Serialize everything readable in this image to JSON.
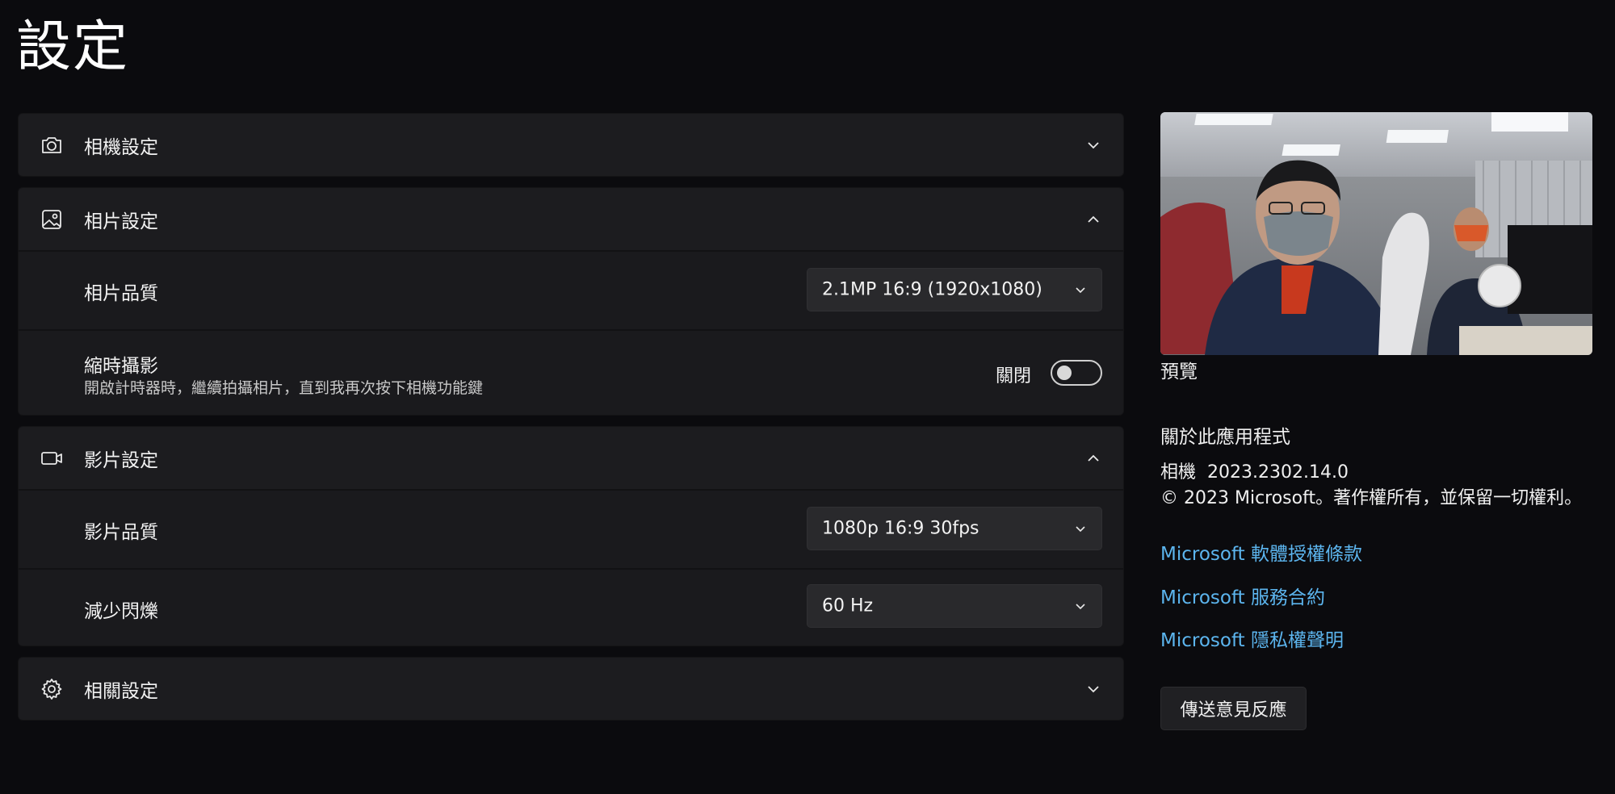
{
  "page": {
    "title": "設定"
  },
  "sections": {
    "camera": {
      "title": "相機設定",
      "icon": "camera-icon",
      "expanded": false
    },
    "photo": {
      "title": "相片設定",
      "icon": "photo-icon",
      "expanded": true,
      "quality": {
        "label": "相片品質",
        "value": "2.1MP 16:9 (1920x1080)"
      },
      "timelapse": {
        "label": "縮時攝影",
        "description": "開啟計時器時，繼續拍攝相片，直到我再次按下相機功能鍵",
        "state_label": "關閉",
        "on": false
      }
    },
    "video": {
      "title": "影片設定",
      "icon": "video-icon",
      "expanded": true,
      "quality": {
        "label": "影片品質",
        "value": "1080p 16:9 30fps"
      },
      "flicker": {
        "label": "減少閃爍",
        "value": "60 Hz"
      }
    },
    "related": {
      "title": "相關設定",
      "icon": "gear-icon",
      "expanded": false
    }
  },
  "sidebar": {
    "preview_caption": "預覽",
    "about_title": "關於此應用程式",
    "app_name": "相機",
    "app_version": "2023.2302.14.0",
    "copyright": "© 2023 Microsoft。著作權所有，並保留一切權利。",
    "links": [
      "Microsoft 軟體授權條款",
      "Microsoft 服務合約",
      "Microsoft 隱私權聲明"
    ],
    "feedback_button": "傳送意見反應"
  },
  "colors": {
    "background": "#0b0b0e",
    "card": "#1c1c1f",
    "link": "#5cb5ee",
    "dropdown": "#29292c"
  }
}
